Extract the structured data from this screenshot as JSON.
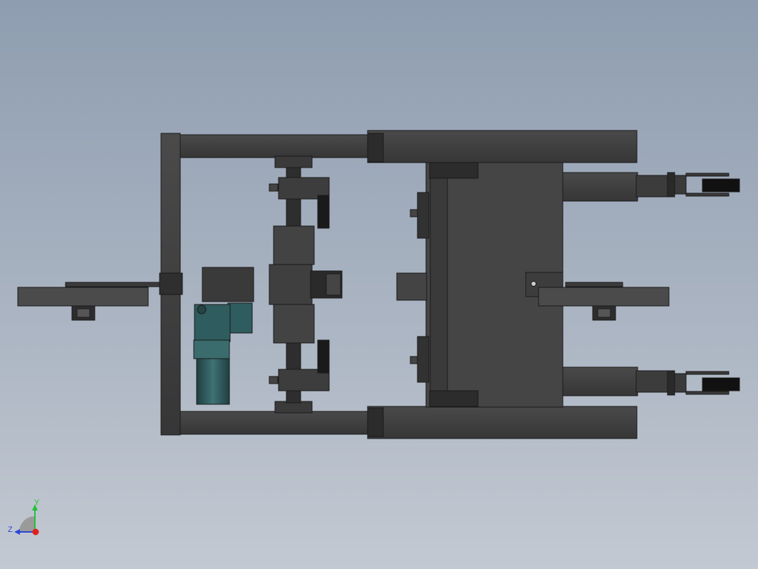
{
  "viewport": {
    "background_top": "#8e9db0",
    "background_bottom": "#c3c9d2"
  },
  "model": {
    "frame_color": "#3f3f40",
    "frame_edge_color": "#1a1a1a",
    "motor_color": "#2f5c5e",
    "tire_color": "#111111"
  },
  "triad": {
    "y_label": "Y",
    "z_label": "Z",
    "x_color": "#e0201b",
    "y_color": "#25c13a",
    "z_color": "#2b46d4"
  }
}
